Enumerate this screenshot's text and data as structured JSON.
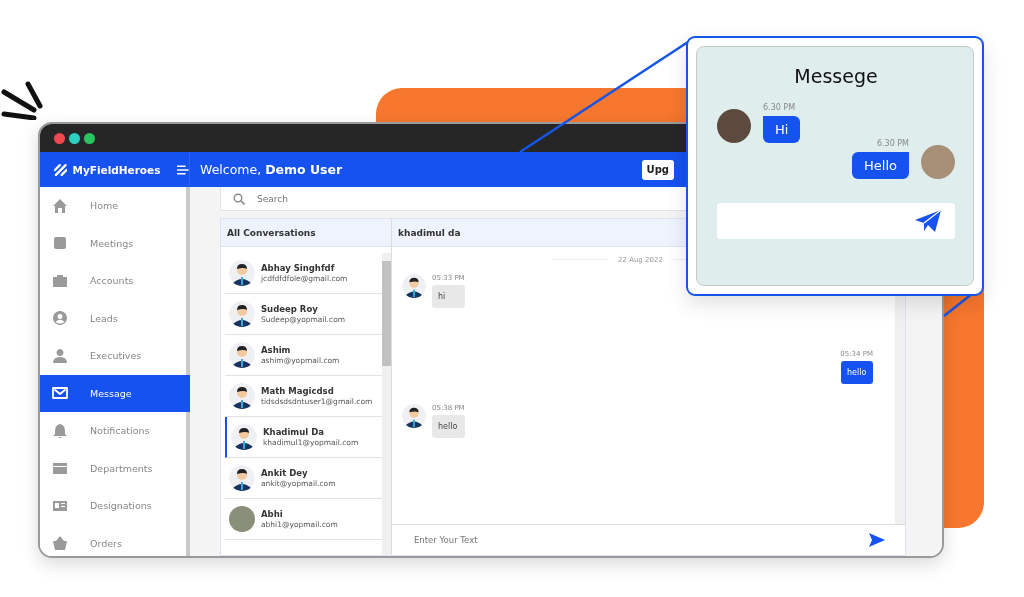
{
  "brand": "MyFieldHeroes",
  "welcome": "Welcome, **Demo User**",
  "upgrade_button": "Upg",
  "sidebar": {
    "items": [
      {
        "label": "Home",
        "kind": "home",
        "selected": false
      },
      {
        "label": "Meetings",
        "kind": "meetings",
        "selected": false
      },
      {
        "label": "Accounts",
        "kind": "accounts",
        "selected": false
      },
      {
        "label": "Leads",
        "kind": "leads",
        "selected": false
      },
      {
        "label": "Executives",
        "kind": "executives",
        "selected": false
      },
      {
        "label": "Message",
        "kind": "message",
        "selected": true
      },
      {
        "label": "Notifications",
        "kind": "notifications",
        "selected": false
      },
      {
        "label": "Departments",
        "kind": "departments",
        "selected": false
      },
      {
        "label": "Designations",
        "kind": "designations",
        "selected": false
      },
      {
        "label": "Orders",
        "kind": "orders",
        "selected": false
      }
    ]
  },
  "search": {
    "placeholder": "Search"
  },
  "conversations": {
    "title": "All Conversations",
    "items": [
      {
        "name": "Abhay Singhfdf",
        "email": "jcdfdfdfole@gmail.com",
        "kind": "cartoon",
        "selected": false
      },
      {
        "name": "Sudeep Roy",
        "email": "Sudeep@yopmail.com",
        "kind": "cartoon",
        "selected": false
      },
      {
        "name": "Ashim",
        "email": "ashim@yopmail.com",
        "kind": "cartoon",
        "selected": false
      },
      {
        "name": "Math Magicdsd",
        "email": "tidsdsdsdntuser1@gmail.com",
        "kind": "cartoon",
        "selected": false
      },
      {
        "name": "Khadimul Da",
        "email": "khadimul1@yopmail.com",
        "kind": "cartoon",
        "selected": true
      },
      {
        "name": "Ankit Dey",
        "email": "ankit@yopmail.com",
        "kind": "cartoon",
        "selected": false
      },
      {
        "name": "Abhi",
        "email": "abhi1@yopmail.com",
        "kind": "photo",
        "selected": false
      }
    ]
  },
  "chat": {
    "title": "khadimul da",
    "date": "22 Aug 2022",
    "messages": [
      {
        "time": "05:33 PM",
        "text": "hi",
        "outgoing": false
      },
      {
        "time": "05:34 PM",
        "text": "hello",
        "outgoing": true
      },
      {
        "time": "05:38 PM",
        "text": "hello",
        "outgoing": false
      }
    ],
    "input": {
      "placeholder": "Enter Your Text"
    }
  },
  "callout": {
    "title": "Messege",
    "messages": [
      {
        "time": "6.30 PM",
        "text": "Hi",
        "outgoing": false
      },
      {
        "time": "6.30 PM",
        "text": "Hello",
        "outgoing": true
      }
    ]
  }
}
